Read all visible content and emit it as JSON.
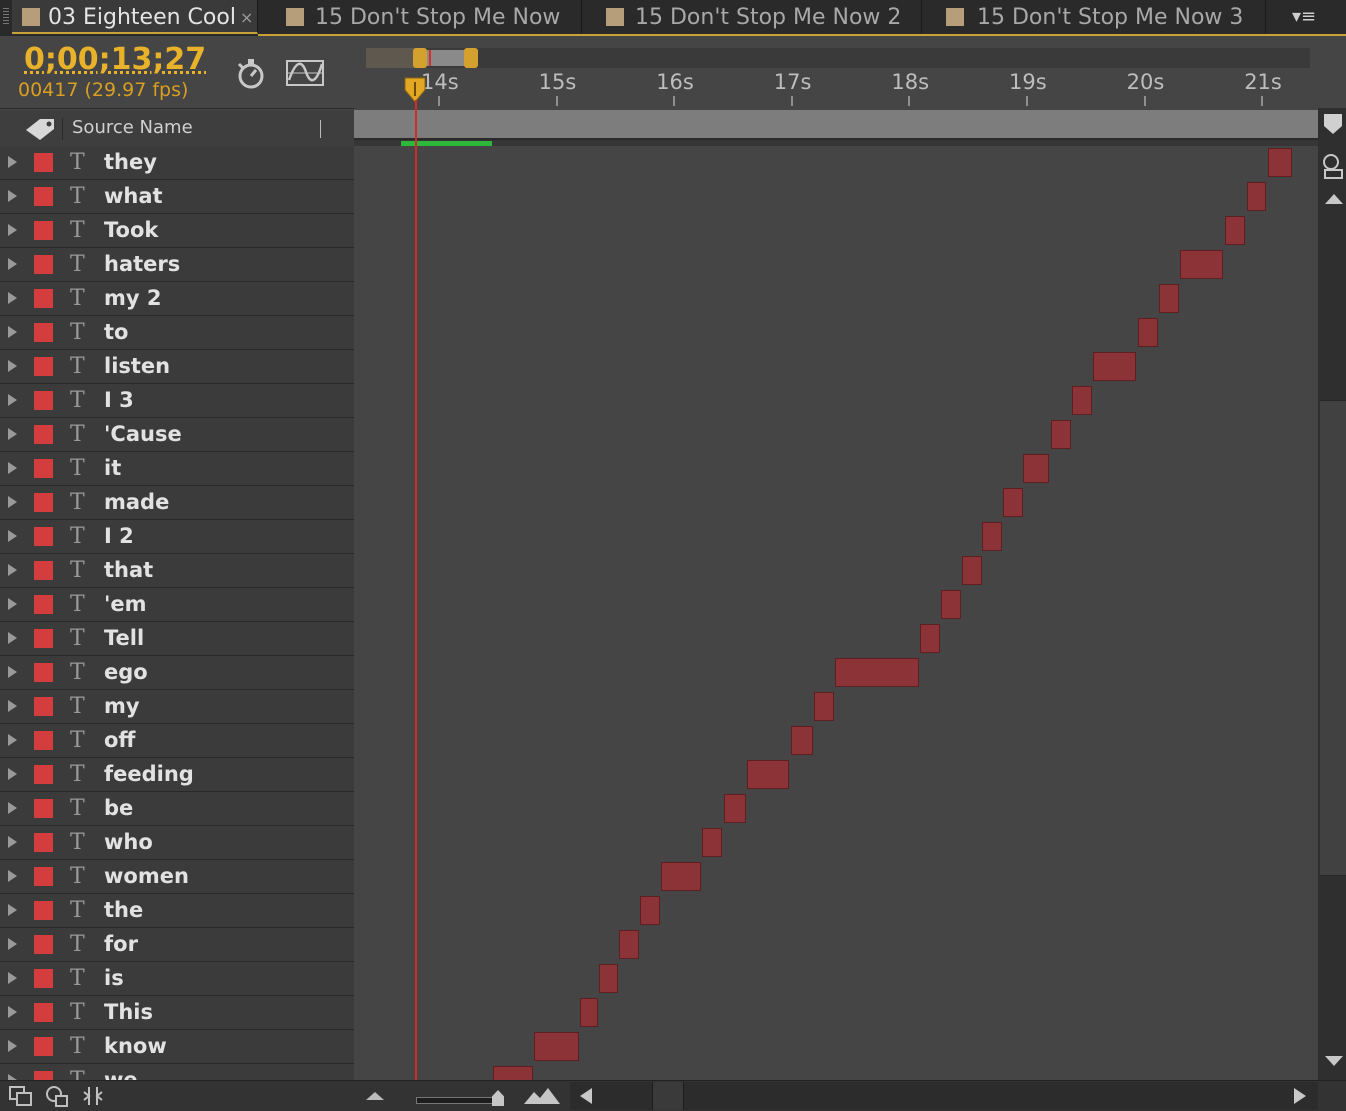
{
  "tabs": [
    {
      "label": "03 Eighteen Cool",
      "active": true,
      "close": "×"
    },
    {
      "label": "15 Don't Stop Me Now",
      "active": false
    },
    {
      "label": "15 Don't Stop Me Now 2",
      "active": false
    },
    {
      "label": "15 Don't Stop Me Now 3",
      "active": false
    }
  ],
  "panel_menu_glyph": "▾≡",
  "timecode": "0;00;13;27",
  "frame_info": "00417 (29.97 fps)",
  "column_header": "Source Name",
  "ruler": {
    "labels": [
      "14s",
      "15s",
      "16s",
      "17s",
      "18s",
      "19s",
      "20s",
      "21s"
    ],
    "start_seconds": 13.62,
    "end_seconds": 21.9,
    "current_time_seconds": 13.9
  },
  "layers": [
    {
      "name": "they",
      "type_icon": "T",
      "in_s": 21.05,
      "out_s": 21.25
    },
    {
      "name": "what",
      "type_icon": "T",
      "in_s": 20.87,
      "out_s": 21.03
    },
    {
      "name": "Took",
      "type_icon": "T",
      "in_s": 20.68,
      "out_s": 20.85
    },
    {
      "name": "haters",
      "type_icon": "T",
      "in_s": 20.3,
      "out_s": 20.67
    },
    {
      "name": "my 2",
      "type_icon": "T",
      "in_s": 20.12,
      "out_s": 20.29
    },
    {
      "name": "to",
      "type_icon": "T",
      "in_s": 19.94,
      "out_s": 20.11
    },
    {
      "name": "listen",
      "type_icon": "T",
      "in_s": 19.56,
      "out_s": 19.93
    },
    {
      "name": "I 3",
      "type_icon": "T",
      "in_s": 19.38,
      "out_s": 19.55
    },
    {
      "name": "'Cause",
      "type_icon": "T",
      "in_s": 19.2,
      "out_s": 19.37
    },
    {
      "name": "it",
      "type_icon": "T",
      "in_s": 18.97,
      "out_s": 19.19
    },
    {
      "name": "made",
      "type_icon": "T",
      "in_s": 18.8,
      "out_s": 18.97
    },
    {
      "name": "I 2",
      "type_icon": "T",
      "in_s": 18.62,
      "out_s": 18.79
    },
    {
      "name": "that",
      "type_icon": "T",
      "in_s": 18.45,
      "out_s": 18.62
    },
    {
      "name": "'em",
      "type_icon": "T",
      "in_s": 18.27,
      "out_s": 18.44
    },
    {
      "name": "Tell",
      "type_icon": "T",
      "in_s": 18.09,
      "out_s": 18.26
    },
    {
      "name": "ego",
      "type_icon": "T",
      "in_s": 17.37,
      "out_s": 18.08
    },
    {
      "name": "my",
      "type_icon": "T",
      "in_s": 17.19,
      "out_s": 17.36
    },
    {
      "name": "off",
      "type_icon": "T",
      "in_s": 16.99,
      "out_s": 17.18
    },
    {
      "name": "feeding",
      "type_icon": "T",
      "in_s": 16.62,
      "out_s": 16.98
    },
    {
      "name": "be",
      "type_icon": "T",
      "in_s": 16.42,
      "out_s": 16.61
    },
    {
      "name": "who",
      "type_icon": "T",
      "in_s": 16.24,
      "out_s": 16.41
    },
    {
      "name": "women",
      "type_icon": "T",
      "in_s": 15.89,
      "out_s": 16.23
    },
    {
      "name": "the",
      "type_icon": "T",
      "in_s": 15.71,
      "out_s": 15.88
    },
    {
      "name": "for",
      "type_icon": "T",
      "in_s": 15.53,
      "out_s": 15.7
    },
    {
      "name": "is",
      "type_icon": "T",
      "in_s": 15.36,
      "out_s": 15.52
    },
    {
      "name": "This",
      "type_icon": "T",
      "in_s": 15.2,
      "out_s": 15.35
    },
    {
      "name": "know",
      "type_icon": "T",
      "in_s": 14.81,
      "out_s": 15.19
    },
    {
      "name": "we",
      "type_icon": "T",
      "in_s": 14.46,
      "out_s": 14.8
    }
  ],
  "colors": {
    "label_red": "#d43d3d",
    "bar_red": "#8b3336",
    "timecode_gold": "#e8b22a",
    "cti_red": "#d22a2a",
    "work_area_green": "#2db83b"
  },
  "icons": {
    "stopwatch": "stopwatch-icon",
    "graph_editor": "graph-editor-icon",
    "label": "label-tag-icon",
    "comp_flowchart": "comp-flowchart-icon"
  }
}
